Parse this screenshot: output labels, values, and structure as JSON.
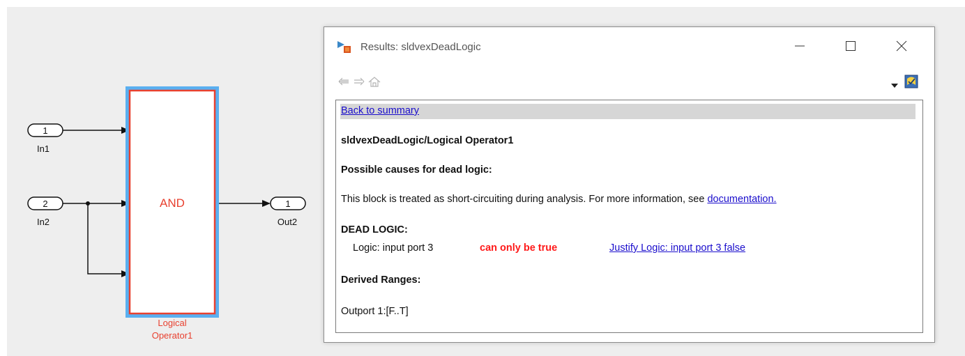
{
  "diagram": {
    "inports": [
      {
        "number": "1",
        "name": "In1"
      },
      {
        "number": "2",
        "name": "In2"
      }
    ],
    "outport": {
      "number": "1",
      "name": "Out2"
    },
    "block": {
      "operator": "AND",
      "caption_line1": "Logical",
      "caption_line2": "Operator1"
    }
  },
  "window": {
    "title": "Results: sldvexDeadLogic",
    "back_link": "Back to summary",
    "path_title": "sldvexDeadLogic/Logical Operator1",
    "causes_heading": "Possible causes for dead logic:",
    "causes_text": "This block is treated as short-circuiting during analysis. For more information, see ",
    "doc_link": "documentation.",
    "dead_heading": "DEAD LOGIC:",
    "dead_item": "Logic: input port 3",
    "dead_status": "can only be true",
    "justify_link": "Justify Logic: input port 3 false",
    "ranges_heading": "Derived Ranges:",
    "ranges_text": "Outport 1:[F..T]"
  },
  "colors": {
    "block_highlight": "#5aaff0",
    "block_border": "#e8402f",
    "link": "#1a0dcc",
    "dead_status": "#ff1a1a"
  },
  "icons": [
    "results-app-icon",
    "minimize-icon",
    "maximize-icon",
    "close-icon",
    "back-arrow-icon",
    "forward-arrow-icon",
    "home-icon",
    "dropdown-arrow-icon",
    "help-icon"
  ]
}
